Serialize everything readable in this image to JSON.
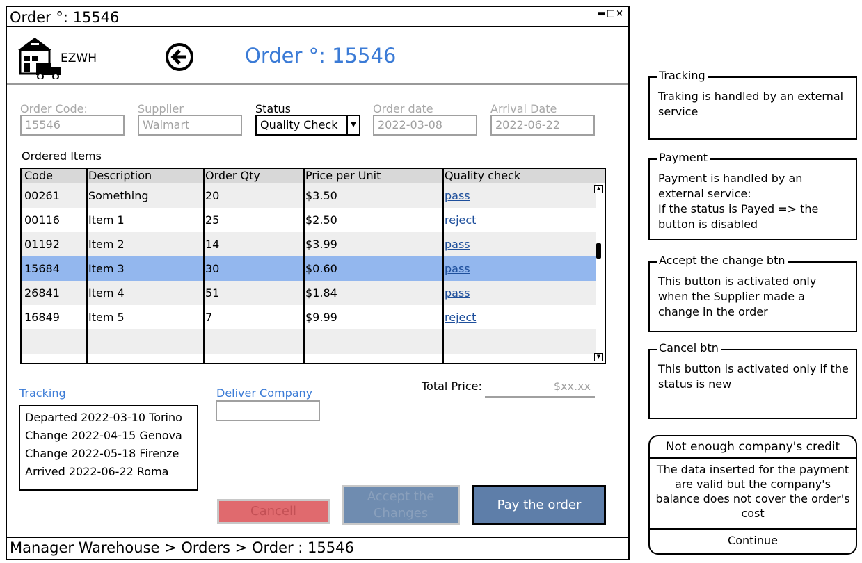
{
  "window": {
    "title": "Order °: 15546",
    "controls": [
      "minimize",
      "maximize",
      "close"
    ]
  },
  "header": {
    "logo_text": "EZWH",
    "page_title": "Order °: 15546"
  },
  "form": {
    "order_code": {
      "label": "Order Code:",
      "value": "15546"
    },
    "supplier": {
      "label": "Supplier",
      "value": "Walmart"
    },
    "status": {
      "label": "Status",
      "value": "Quality Check"
    },
    "order_date": {
      "label": "Order date",
      "value": "2022-03-08"
    },
    "arrival_date": {
      "label": "Arrival Date",
      "value": "2022-06-22"
    }
  },
  "items": {
    "title": "Ordered Items",
    "columns": [
      "Code",
      "Description",
      "Order Qty",
      "Price per Unit",
      "Quality check"
    ],
    "rows": [
      {
        "code": "00261",
        "description": "Something",
        "qty": "20",
        "price": "$3.50",
        "quality": "pass"
      },
      {
        "code": "00116",
        "description": "Item 1",
        "qty": "25",
        "price": "$2.50",
        "quality": "reject"
      },
      {
        "code": "01192",
        "description": "Item 2",
        "qty": "14",
        "price": "$3.99",
        "quality": "pass"
      },
      {
        "code": "15684",
        "description": "Item 3",
        "qty": "30",
        "price": "$0.60",
        "quality": "pass"
      },
      {
        "code": "26841",
        "description": "Item 4",
        "qty": "51",
        "price": "$1.84",
        "quality": "pass"
      },
      {
        "code": "16849",
        "description": "Item 5",
        "qty": "7",
        "price": "$9.99",
        "quality": "reject"
      }
    ],
    "selected_row": 3
  },
  "tracking": {
    "label": "Tracking",
    "entries": [
      "Departed 2022-03-10 Torino",
      "Change 2022-04-15 Genova",
      "Change 2022-05-18 Firenze",
      "Arrived 2022-06-22 Roma"
    ]
  },
  "deliver_company": {
    "label": "Deliver Company",
    "value": ""
  },
  "total": {
    "label": "Total Price:",
    "value": "$xx.xx"
  },
  "buttons": {
    "cancel": "Cancell",
    "accept": "Accept the Changes",
    "pay": "Pay the order"
  },
  "breadcrumb": "Manager Warehouse > Orders > Order : 15546",
  "notes": [
    {
      "title": "Tracking",
      "body": "Traking is handled by an external service"
    },
    {
      "title": "Payment",
      "body": "Payment is handled by an external service:\nIf the status is Payed => the button is disabled"
    },
    {
      "title": "Accept the change btn",
      "body": "This button is activated only when the Supplier made a change in the order"
    },
    {
      "title": "Cancel btn",
      "body": "This button is activated only if the status is new"
    }
  ],
  "dialog": {
    "title": "Not enough company's credit",
    "body": "The data inserted for the payment are valid but the company's balance does not cover the order's cost",
    "button": "Continue"
  },
  "colors": {
    "accent": "#3b7bd6",
    "selected_row": "#93b7ee",
    "cancel_button": "#e06a6e",
    "accept_button": "#6f8cb0",
    "pay_button": "#5e7ea9",
    "link": "#1e4f9c"
  }
}
